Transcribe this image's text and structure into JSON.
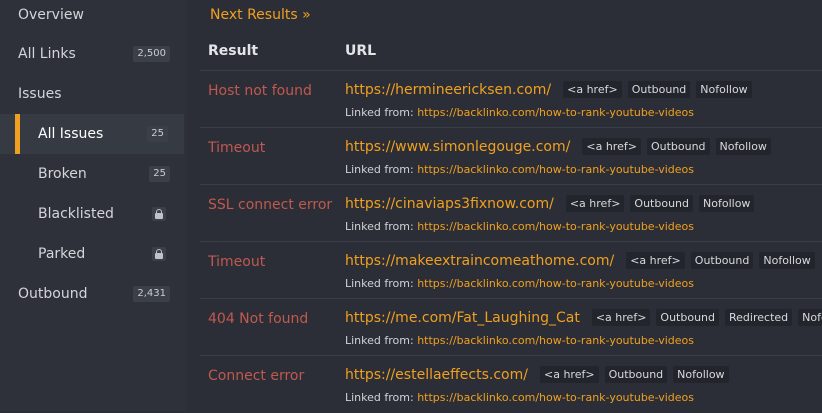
{
  "sidebar": {
    "items": [
      {
        "label": "Overview"
      },
      {
        "label": "All Links",
        "count": "2,500"
      },
      {
        "label": "Issues"
      },
      {
        "label": "All Issues",
        "count": "25"
      },
      {
        "label": "Broken",
        "count": "25"
      },
      {
        "label": "Blacklisted",
        "icon": "lock-icon"
      },
      {
        "label": "Parked",
        "icon": "lock-icon"
      },
      {
        "label": "Outbound",
        "count": "2,431"
      }
    ],
    "accent_color": "#f0a020"
  },
  "main": {
    "next_results": "Next Results »",
    "headers": {
      "result": "Result",
      "url": "URL"
    },
    "linked_from_label": "Linked from:",
    "rows": [
      {
        "result": "Host not found",
        "url": "https://hermineericksen.com/",
        "tags": [
          "<a href>",
          "Outbound",
          "Nofollow"
        ],
        "source": "https://backlinko.com/how-to-rank-youtube-videos"
      },
      {
        "result": "Timeout",
        "url": "https://www.simonlegouge.com/",
        "tags": [
          "<a href>",
          "Outbound",
          "Nofollow"
        ],
        "source": "https://backlinko.com/how-to-rank-youtube-videos"
      },
      {
        "result": "SSL connect error",
        "url": "https://cinaviaps3fixnow.com/",
        "tags": [
          "<a href>",
          "Outbound",
          "Nofollow"
        ],
        "source": "https://backlinko.com/how-to-rank-youtube-videos"
      },
      {
        "result": "Timeout",
        "url": "https://makeextraincomeathome.com/",
        "tags": [
          "<a href>",
          "Outbound",
          "Nofollow"
        ],
        "source": "https://backlinko.com/how-to-rank-youtube-videos"
      },
      {
        "result": "404 Not found",
        "url": "https://me.com/Fat_Laughing_Cat",
        "tags": [
          "<a href>",
          "Outbound",
          "Redirected",
          "Nofollow"
        ],
        "source": "https://backlinko.com/how-to-rank-youtube-videos"
      },
      {
        "result": "Connect error",
        "url": "https://estellaeffects.com/",
        "tags": [
          "<a href>",
          "Outbound",
          "Nofollow"
        ],
        "source": "https://backlinko.com/how-to-rank-youtube-videos"
      }
    ],
    "result_color": "#c0594f"
  }
}
